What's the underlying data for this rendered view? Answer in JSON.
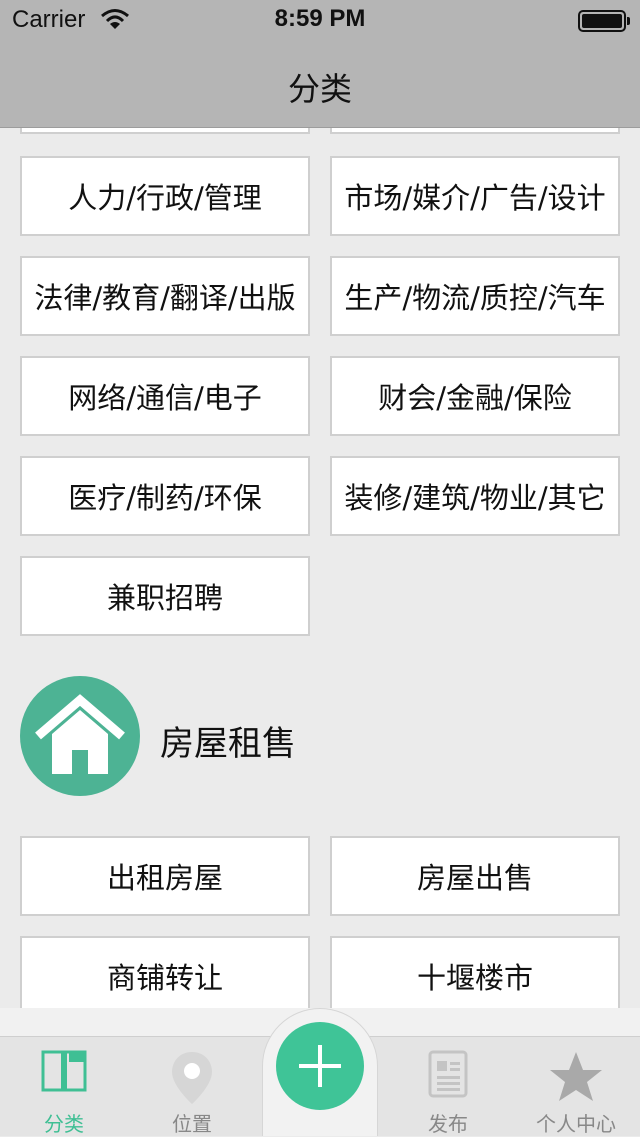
{
  "status_bar": {
    "carrier": "Carrier",
    "time": "8:59 PM"
  },
  "nav": {
    "title": "分类"
  },
  "job_categories": [
    {
      "left": "人力/行政/管理",
      "right": "市场/媒介/广告/设计"
    },
    {
      "left": "法律/教育/翻译/出版",
      "right": "生产/物流/质控/汽车"
    },
    {
      "left": "网络/通信/电子",
      "right": "财会/金融/保险"
    },
    {
      "left": "医疗/制药/环保",
      "right": "装修/建筑/物业/其它"
    },
    {
      "left": "兼职招聘"
    }
  ],
  "housing_section": {
    "title": "房屋租售",
    "icon": "house-icon",
    "items": [
      {
        "left": "出租房屋",
        "right": "房屋出售"
      },
      {
        "left": "商铺转让",
        "right": "十堰楼市"
      }
    ]
  },
  "tab_bar": {
    "tabs": [
      {
        "label": "分类",
        "icon": "book-icon",
        "active": true
      },
      {
        "label": "位置",
        "icon": "location-pin-icon",
        "active": false
      },
      {
        "label": "发布",
        "icon": "document-icon",
        "active": false
      },
      {
        "label": "个人中心",
        "icon": "star-icon",
        "active": false
      }
    ],
    "center_icon": "plus-icon"
  },
  "colors": {
    "accent": "#3fc497",
    "section_icon_bg": "#4db394",
    "nav_bg": "#b5b5b5",
    "page_bg": "#ebebeb",
    "inactive_tab": "#888888"
  }
}
